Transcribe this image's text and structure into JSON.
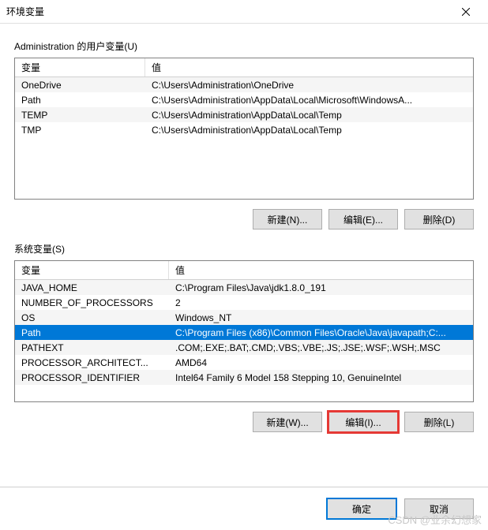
{
  "window": {
    "title": "环境变量"
  },
  "user_section": {
    "label": "Administration 的用户变量(U)",
    "columns": {
      "var": "变量",
      "val": "值"
    },
    "rows": [
      {
        "name": "OneDrive",
        "value": "C:\\Users\\Administration\\OneDrive"
      },
      {
        "name": "Path",
        "value": "C:\\Users\\Administration\\AppData\\Local\\Microsoft\\WindowsA..."
      },
      {
        "name": "TEMP",
        "value": "C:\\Users\\Administration\\AppData\\Local\\Temp"
      },
      {
        "name": "TMP",
        "value": "C:\\Users\\Administration\\AppData\\Local\\Temp"
      }
    ],
    "buttons": {
      "new": "新建(N)...",
      "edit": "编辑(E)...",
      "delete": "删除(D)"
    }
  },
  "system_section": {
    "label": "系统变量(S)",
    "columns": {
      "var": "变量",
      "val": "值"
    },
    "rows": [
      {
        "name": "JAVA_HOME",
        "value": "C:\\Program Files\\Java\\jdk1.8.0_191"
      },
      {
        "name": "NUMBER_OF_PROCESSORS",
        "value": "2"
      },
      {
        "name": "OS",
        "value": "Windows_NT"
      },
      {
        "name": "Path",
        "value": "C:\\Program Files (x86)\\Common Files\\Oracle\\Java\\javapath;C:..."
      },
      {
        "name": "PATHEXT",
        "value": ".COM;.EXE;.BAT;.CMD;.VBS;.VBE;.JS;.JSE;.WSF;.WSH;.MSC"
      },
      {
        "name": "PROCESSOR_ARCHITECT...",
        "value": "AMD64"
      },
      {
        "name": "PROCESSOR_IDENTIFIER",
        "value": "Intel64 Family 6 Model 158 Stepping 10, GenuineIntel"
      }
    ],
    "selected_index": 3,
    "buttons": {
      "new": "新建(W)...",
      "edit": "编辑(I)...",
      "delete": "删除(L)"
    }
  },
  "footer": {
    "ok": "确定",
    "cancel": "取消"
  },
  "watermark": "CSDN @业余幻想家"
}
